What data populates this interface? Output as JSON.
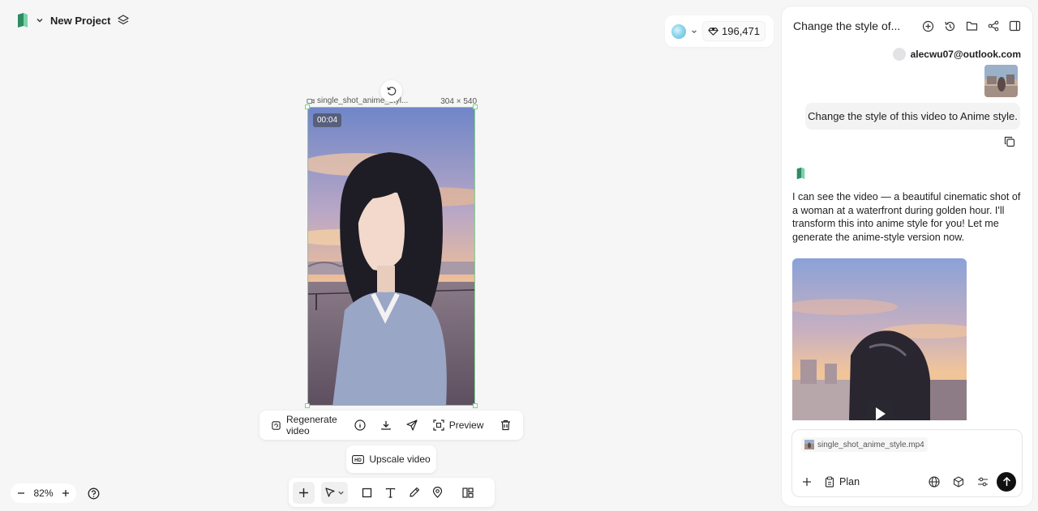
{
  "project": {
    "title": "New Project",
    "logo_icon": "app-logo-icon",
    "layers_icon": "layers-icon"
  },
  "credits": {
    "value": "196,471",
    "icon": "gem-icon",
    "orb_color": "#8fd6ec"
  },
  "canvas": {
    "frame_name": "single_shot_anime_styl...",
    "frame_size": "304 × 540",
    "duration": "00:04",
    "selection_color": "#7fd08a"
  },
  "action_bar": {
    "regenerate_label": "Regenerate video",
    "preview_label": "Preview"
  },
  "upscale_label": "Upscale video",
  "zoom": {
    "level": "82%"
  },
  "chat": {
    "title": "Change the style of...",
    "user_email": "alecwu07@outlook.com",
    "user_message": "Change the style of this video to Anime style.",
    "ai_message": "I can see the video — a beautiful cinematic shot of a woman at a waterfront during golden hour. I'll transform this into anime style for you! Let me generate the anime-style version now.",
    "attachment_name": "single_shot_anime_style.mp4",
    "plan_label": "Plan"
  }
}
